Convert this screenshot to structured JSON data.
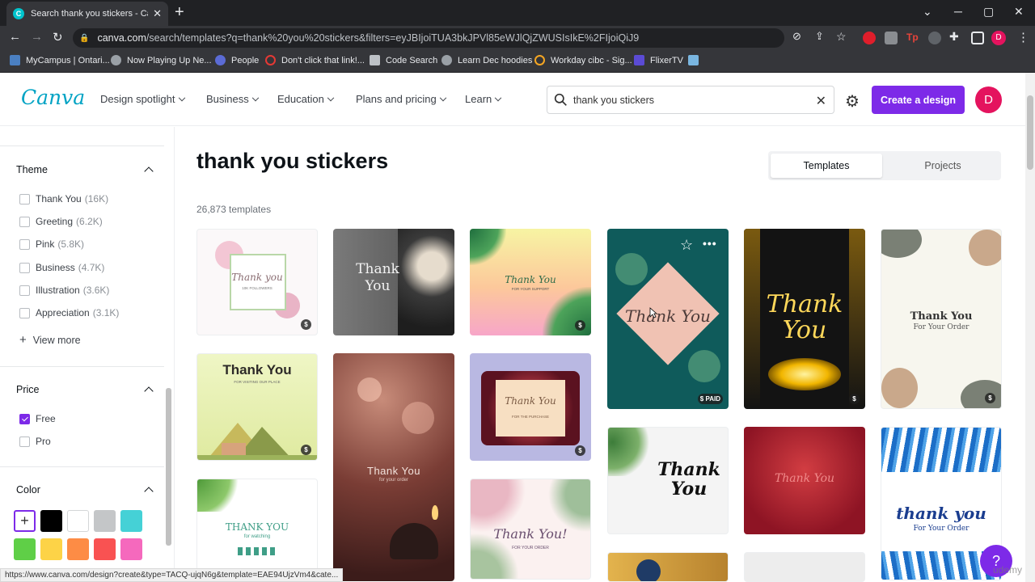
{
  "browser": {
    "tab_title": "Search thank you stickers - Canva",
    "url_domain": "canva.com",
    "url_rest": "/search/templates?q=thank%20you%20stickers&filters=eyJBIjoiTUA3bkJPVl85eWJlQjZWUSIsIkE%2FIjoiQiJ9",
    "bookmarks": [
      "MyCampus | Ontari...",
      "Now Playing Up Ne...",
      "People",
      "Don't click that link!...",
      "Code Search",
      "Learn Dec hoodies",
      "Workday cibc - Sig...",
      "FlixerTV"
    ],
    "status_url": "https://www.canva.com/design?create&type=TACQ-ujqN6g&template=EAE94UjzVm4&cate...",
    "profile_initial": "D"
  },
  "header": {
    "logo": "Canva",
    "menu": [
      "Design spotlight",
      "Business",
      "Education",
      "Plans and pricing",
      "Learn"
    ],
    "search_value": "thank you stickers",
    "create_label": "Create a design",
    "avatar_initial": "D"
  },
  "sidebar": {
    "theme_title": "Theme",
    "themes": [
      {
        "label": "Thank You",
        "count": "(16K)"
      },
      {
        "label": "Greeting",
        "count": "(6.2K)"
      },
      {
        "label": "Pink",
        "count": "(5.8K)"
      },
      {
        "label": "Business",
        "count": "(4.7K)"
      },
      {
        "label": "Illustration",
        "count": "(3.6K)"
      },
      {
        "label": "Appreciation",
        "count": "(3.1K)"
      }
    ],
    "view_more": "View more",
    "price_title": "Price",
    "price_options": [
      {
        "label": "Free",
        "checked": true
      },
      {
        "label": "Pro",
        "checked": false
      }
    ],
    "color_title": "Color",
    "colors": [
      "#000000",
      "#ffffff",
      "#c4c6c8",
      "#45d1d6",
      "#5fcf47",
      "#fdd347",
      "#fd8c45",
      "#f95252",
      "#f569bd"
    ]
  },
  "main": {
    "title": "thank you stickers",
    "count": "26,873 templates",
    "tabs": [
      "Templates",
      "Projects"
    ],
    "tiles": {
      "t1": {
        "text": "Thank you",
        "sub": "10K FOLLOWERS",
        "price": "$"
      },
      "t2": {
        "text": "Thank You"
      },
      "t3": {
        "text": "Thank You",
        "sub": "FOR YOUR SUPPORT",
        "price": "$"
      },
      "t4": {
        "text": "Thank You",
        "price": "$ PAID"
      },
      "t5": {
        "text": "Thank You",
        "price": "$"
      },
      "t6": {
        "text": "Thank You",
        "sub": "For Your Order",
        "price": "$"
      },
      "t7": {
        "text": "Thank You",
        "sub": "FOR VISITING OUR PLACE",
        "price": "$"
      },
      "t8": {
        "text": "Thank You",
        "sub": "for your order"
      },
      "t9": {
        "text": "Thank You",
        "sub": "FOR THE PURCHASE",
        "price": "$"
      },
      "t10": {
        "text": "Thank You"
      },
      "t11": {
        "text": "Thank You"
      },
      "t12": {
        "text": "thank you",
        "sub": "For Your Order"
      },
      "t13": {
        "text": "THANK YOU",
        "sub": "for watching"
      },
      "t14": {
        "text": "Thank You!",
        "sub": "FOR YOUR ORDER"
      }
    }
  },
  "help": "?",
  "watermark": "udemy"
}
